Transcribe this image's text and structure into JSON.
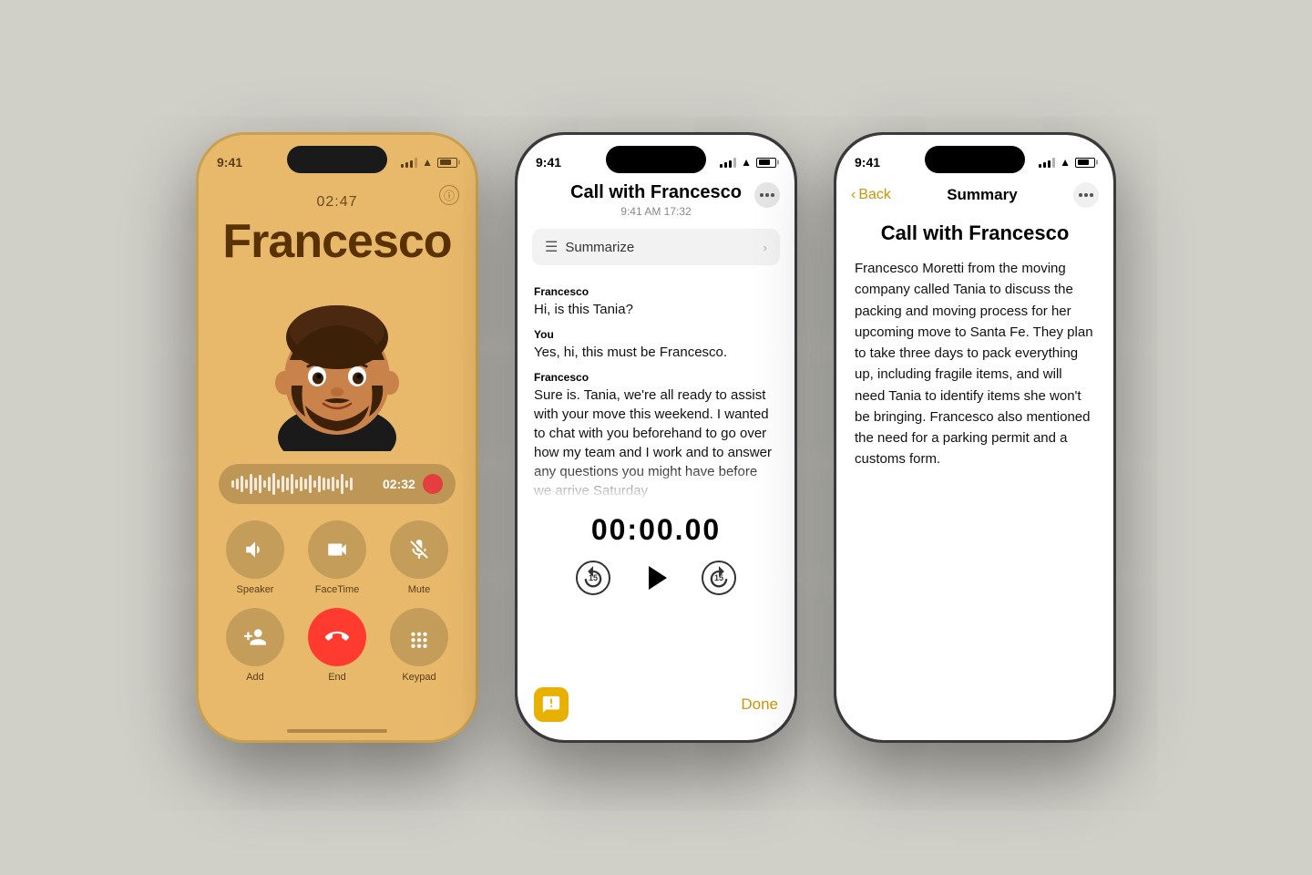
{
  "background_color": "#d0cfc8",
  "phone1": {
    "status_time": "9:41",
    "call_timer": "02:47",
    "caller_name": "Francesco",
    "waveform_time": "02:32",
    "buttons": [
      {
        "label": "Speaker",
        "icon": "speaker"
      },
      {
        "label": "FaceTime",
        "icon": "video"
      },
      {
        "label": "Mute",
        "icon": "mute"
      },
      {
        "label": "Add",
        "icon": "add"
      },
      {
        "label": "End",
        "icon": "end"
      },
      {
        "label": "Keypad",
        "icon": "keypad"
      }
    ]
  },
  "phone2": {
    "status_time": "9:41",
    "title": "Call with Francesco",
    "subtitle": "9:41 AM  17:32",
    "summarize_label": "Summarize",
    "transcript": [
      {
        "speaker": "Francesco",
        "text": "Hi, is this Tania?"
      },
      {
        "speaker": "You",
        "text": "Yes, hi, this must be Francesco."
      },
      {
        "speaker": "Francesco",
        "text": "Sure is. Tania, we're all ready to assist with your move this weekend. I wanted to chat with you beforehand to go over how my team and I work and to answer any questions you might have before we arrive Saturday"
      }
    ],
    "playback_timer": "00:00.00",
    "skip_back_label": "15",
    "skip_forward_label": "15",
    "done_label": "Done"
  },
  "phone3": {
    "status_time": "9:41",
    "back_label": "Back",
    "nav_title": "Summary",
    "title": "Call with Francesco",
    "summary": "Francesco Moretti from the moving company called Tania to discuss the packing and moving process for her upcoming move to Santa Fe. They plan to take three days to pack everything up, including fragile items, and will need Tania to identify items she won't be bringing. Francesco also mentioned the need for a parking permit and a customs form."
  }
}
